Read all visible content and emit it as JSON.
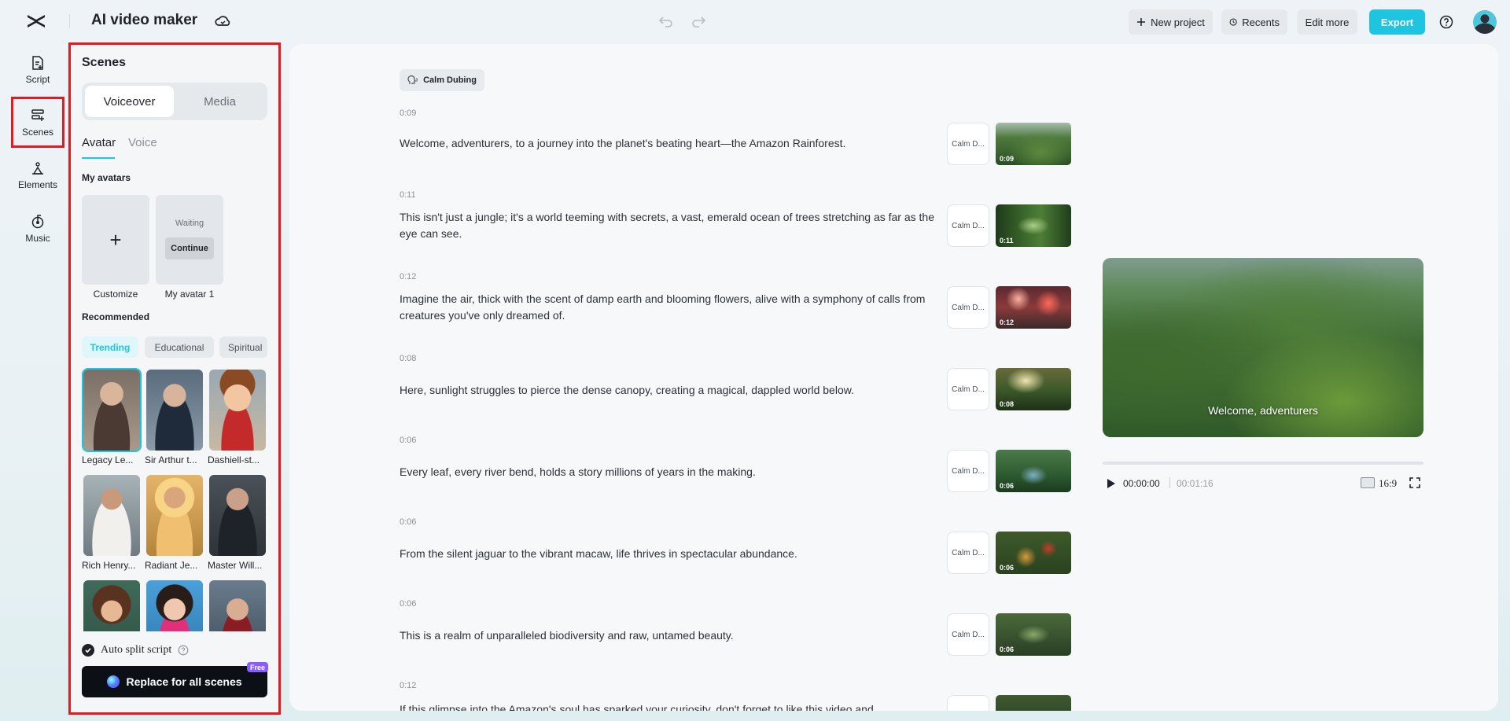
{
  "header": {
    "app_title": "AI video maker",
    "buttons": {
      "new_project": "New project",
      "recents": "Recents",
      "edit_more": "Edit more",
      "export": "Export"
    },
    "accent": "#1ec5e0"
  },
  "rail": [
    {
      "label": "Script",
      "icon": "script-icon"
    },
    {
      "label": "Scenes",
      "icon": "scenes-icon",
      "active": true
    },
    {
      "label": "Elements",
      "icon": "elements-icon"
    },
    {
      "label": "Music",
      "icon": "music-icon"
    }
  ],
  "panel": {
    "title": "Scenes",
    "segments": [
      "Voiceover",
      "Media"
    ],
    "subtabs": [
      "Avatar",
      "Voice"
    ],
    "my_avatars_label": "My avatars",
    "customize_label": "Customize",
    "my_avatar": {
      "name": "My avatar 1",
      "status": "Waiting",
      "action": "Continue"
    },
    "recommended_label": "Recommended",
    "chips": [
      "Trending",
      "Educational",
      "Spiritual"
    ],
    "avatars": [
      "Legacy Le...",
      "Sir Arthur t...",
      "Dashiell-st...",
      "Rich Henry...",
      "Radiant Je...",
      "Master Will...",
      "",
      "",
      ""
    ],
    "auto_split_label": "Auto split script",
    "replace_button": "Replace for all scenes",
    "free_badge": "Free"
  },
  "main": {
    "voice_chip": "Calm Dubing",
    "scenes": [
      {
        "time": "0:09",
        "text": "Welcome, adventurers, to a journey into the planet's beating heart—the Amazon Rainforest.",
        "voice": "Calm D...",
        "thumb_time": "0:09"
      },
      {
        "time": "0:11",
        "text": "This isn't just a jungle; it's a world teeming with secrets, a vast, emerald ocean of trees stretching as far as the eye can see.",
        "voice": "Calm D...",
        "thumb_time": "0:11"
      },
      {
        "time": "0:12",
        "text": "Imagine the air, thick with the scent of damp earth and blooming flowers, alive with a symphony of calls from creatures you've only dreamed of.",
        "voice": "Calm D...",
        "thumb_time": "0:12"
      },
      {
        "time": "0:08",
        "text": "Here, sunlight struggles to pierce the dense canopy, creating a magical, dappled world below.",
        "voice": "Calm D...",
        "thumb_time": "0:08"
      },
      {
        "time": "0:06",
        "text": "Every leaf, every river bend, holds a story millions of years in the making.",
        "voice": "Calm D...",
        "thumb_time": "0:06"
      },
      {
        "time": "0:06",
        "text": "From the silent jaguar to the vibrant macaw, life thrives in spectacular abundance.",
        "voice": "Calm D...",
        "thumb_time": "0:06"
      },
      {
        "time": "0:06",
        "text": "This is a realm of unparalleled biodiversity and raw, untamed beauty.",
        "voice": "Calm D...",
        "thumb_time": "0:06"
      },
      {
        "time": "0:12",
        "text": "If this glimpse into the Amazon's soul has sparked your curiosity, don't forget to like this video and",
        "voice": "",
        "thumb_time": ""
      }
    ],
    "preview": {
      "caption": "Welcome, adventurers",
      "time_current": "00:00:00",
      "time_total": "00:01:16",
      "ratio": "16:9"
    }
  }
}
